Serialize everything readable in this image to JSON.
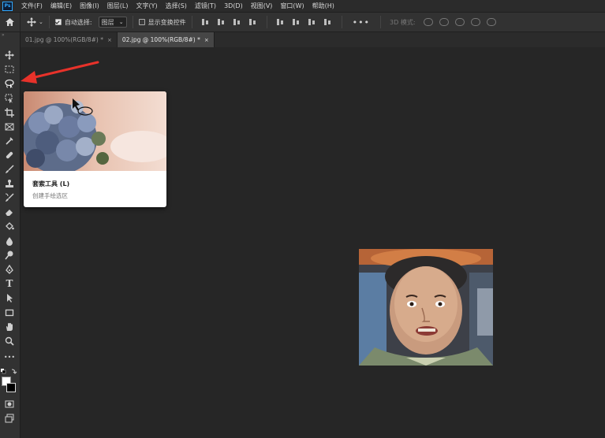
{
  "app": {
    "logo": "Ps"
  },
  "menu": [
    "文件(F)",
    "编辑(E)",
    "图像(I)",
    "图层(L)",
    "文字(Y)",
    "选择(S)",
    "滤镜(T)",
    "3D(D)",
    "视图(V)",
    "窗口(W)",
    "帮助(H)"
  ],
  "options": {
    "auto_select_label": "自动选择:",
    "auto_select_checked": true,
    "auto_select_value": "图层",
    "show_transform_label": "显示变换控件",
    "show_transform_checked": false,
    "more_label": "•••",
    "mode_3d_label": "3D 模式:"
  },
  "tabs": [
    {
      "label": "01.jpg @ 100%(RGB/8#) *",
      "active": false
    },
    {
      "label": "02.jpg @ 100%(RGB/8#) *",
      "active": true
    }
  ],
  "tab_close_glyph": "×",
  "toolbar": {
    "collapse_glyph": "»",
    "tools": [
      "move-tool",
      "rectangular-marquee-tool",
      "lasso-tool",
      "object-selection-tool",
      "crop-tool",
      "frame-tool",
      "eyedropper-tool",
      "spot-healing-tool",
      "brush-tool",
      "clone-stamp-tool",
      "history-brush-tool",
      "eraser-tool",
      "paint-bucket-tool",
      "blur-tool",
      "dodge-tool",
      "pen-tool",
      "type-tool",
      "path-selection-tool",
      "rectangle-tool",
      "hand-tool",
      "zoom-tool",
      "edit-toolbar",
      "quick-mask",
      "screen-mode"
    ],
    "type_tool_glyph": "T",
    "more_glyph": "•••",
    "foreground_color": "#ffffff",
    "background_color": "#000000"
  },
  "tooltip": {
    "title": "套索工具 (L)",
    "description": "创建手绘选区"
  },
  "colors": {
    "annotation_arrow": "#e8322a",
    "canvas_bg": "#262626",
    "panel_bg": "#323232"
  }
}
